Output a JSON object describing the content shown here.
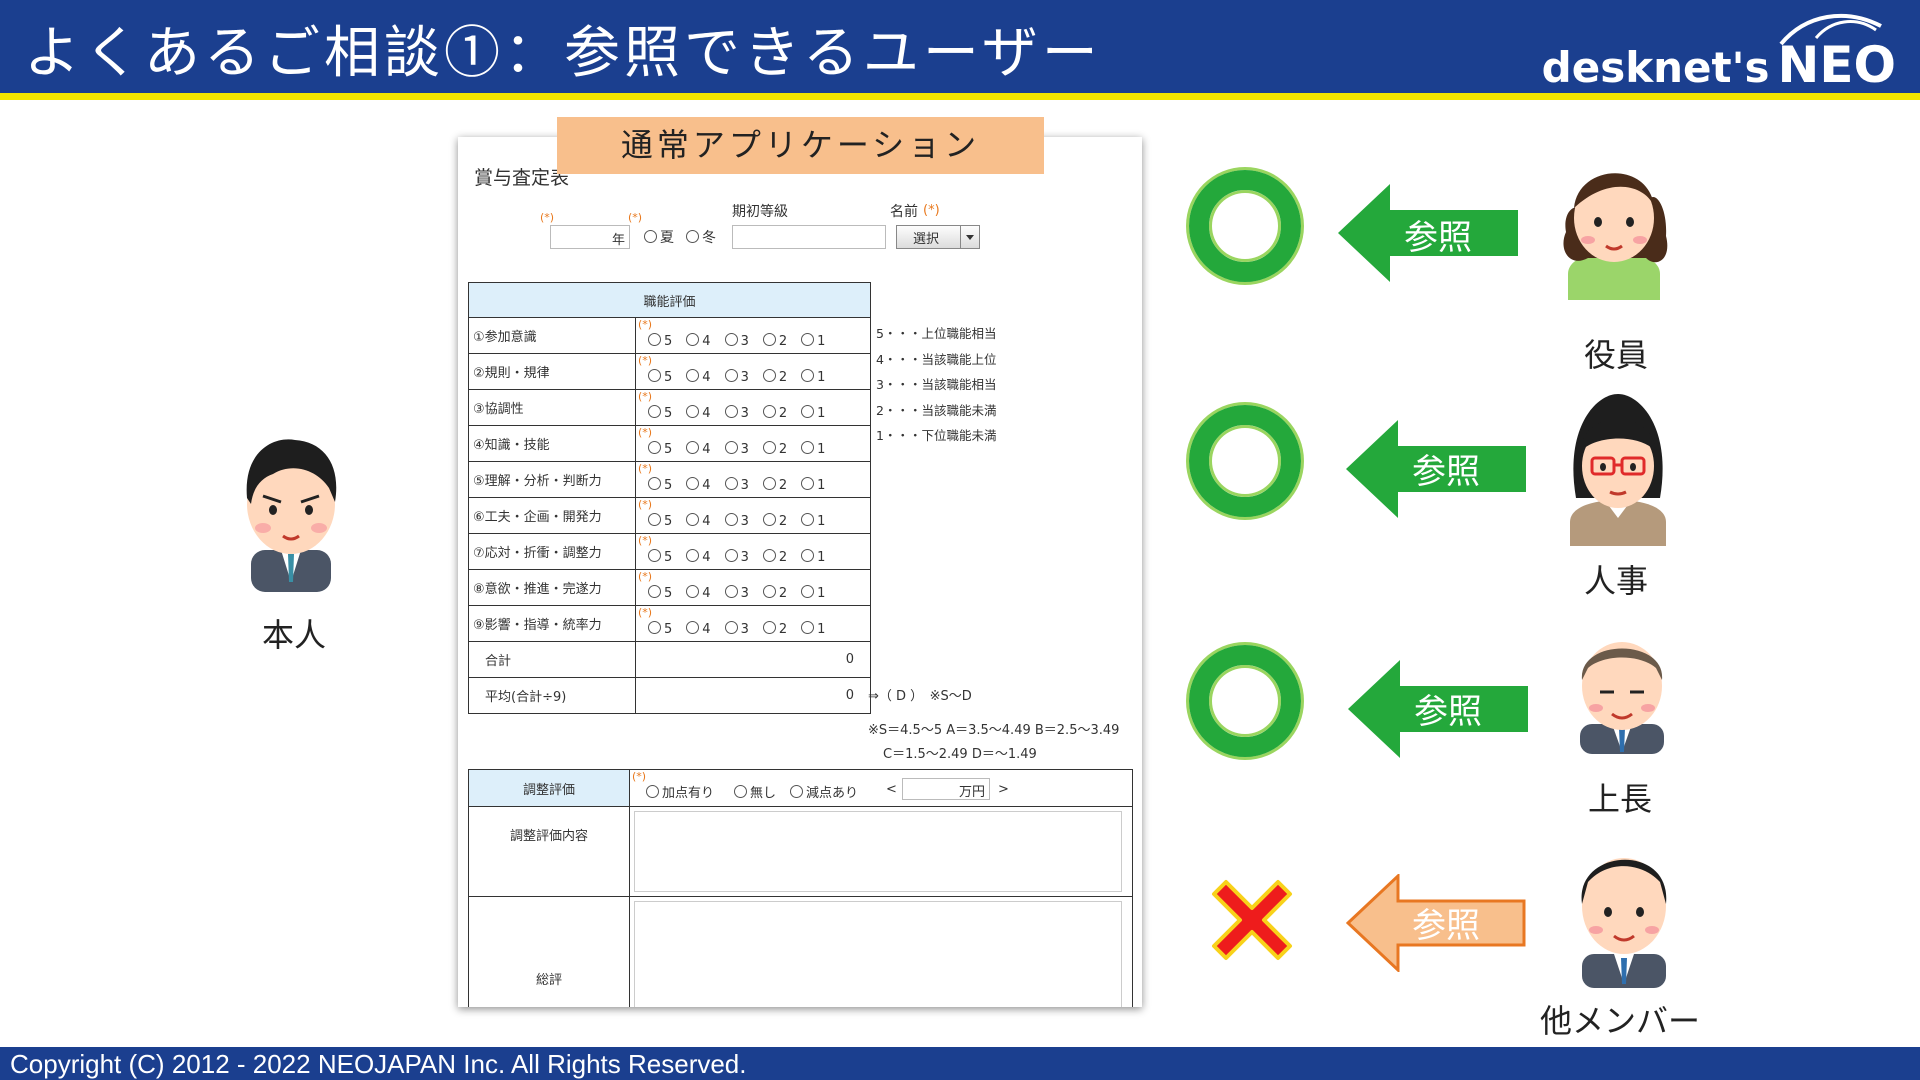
{
  "slide": {
    "title": "よくあるご相談①：参照できるユーザー",
    "logo_desknets": "desknet's",
    "logo_neo": "NEO",
    "copyright": "Copyright (C) 2012 - 2022 NEOJAPAN Inc. All Rights Reserved."
  },
  "app_badge": "通常アプリケーション",
  "form": {
    "title": "賞与査定表",
    "required_mark": "(*)",
    "year_unit": "年",
    "season_summer": "夏",
    "season_winter": "冬",
    "grade_label": "期初等級",
    "name_label": "名前",
    "select_label": "選択",
    "eval_header": "職能評価",
    "criteria": [
      "①参加意識",
      "②規則・規律",
      "③協調性",
      "④知識・技能",
      "⑤理解・分析・判断力",
      "⑥工夫・企画・開発力",
      "⑦応対・折衝・調整力",
      "⑧意欲・推進・完遂力",
      "⑨影響・指導・統率力"
    ],
    "scale_options": [
      "5",
      "4",
      "3",
      "2",
      "1"
    ],
    "legend": [
      "5・・・上位職能相当",
      "4・・・当該職能上位",
      "3・・・当該職能相当",
      "2・・・当該職能未満",
      "1・・・下位職能未満"
    ],
    "total_label": "合計",
    "total_value": "0",
    "average_label": "平均(合計÷9)",
    "average_value": "0",
    "grade_result": "⇒（ D ）　※S〜D",
    "grade_rule_1": "※S＝4.5〜5 A＝3.5〜4.49 B＝2.5〜3.49",
    "grade_rule_2": "C＝1.5〜2.49 D＝〜1.49",
    "adjust_label": "調整評価",
    "adjust_options": [
      "加点有り",
      "無し",
      "減点あり"
    ],
    "amount_prefix": "<",
    "amount_unit": "万円",
    "amount_suffix": ">",
    "adjust_detail_label": "調整評価内容",
    "overall_label": "総評"
  },
  "self_label": "本人",
  "access_rows": [
    {
      "reference_label": "参照",
      "person": "役員",
      "allowed": true
    },
    {
      "reference_label": "参照",
      "person": "人事",
      "allowed": true
    },
    {
      "reference_label": "参照",
      "person": "上長",
      "allowed": true
    },
    {
      "reference_label": "参照",
      "person": "他メンバー",
      "allowed": false
    }
  ],
  "colors": {
    "header": "#1b3f8f",
    "header_accent": "#f3e500",
    "allowed": "#24a83b",
    "denied_arrow": "#f8bf8c",
    "denied_mark": "#ee1c1c"
  }
}
